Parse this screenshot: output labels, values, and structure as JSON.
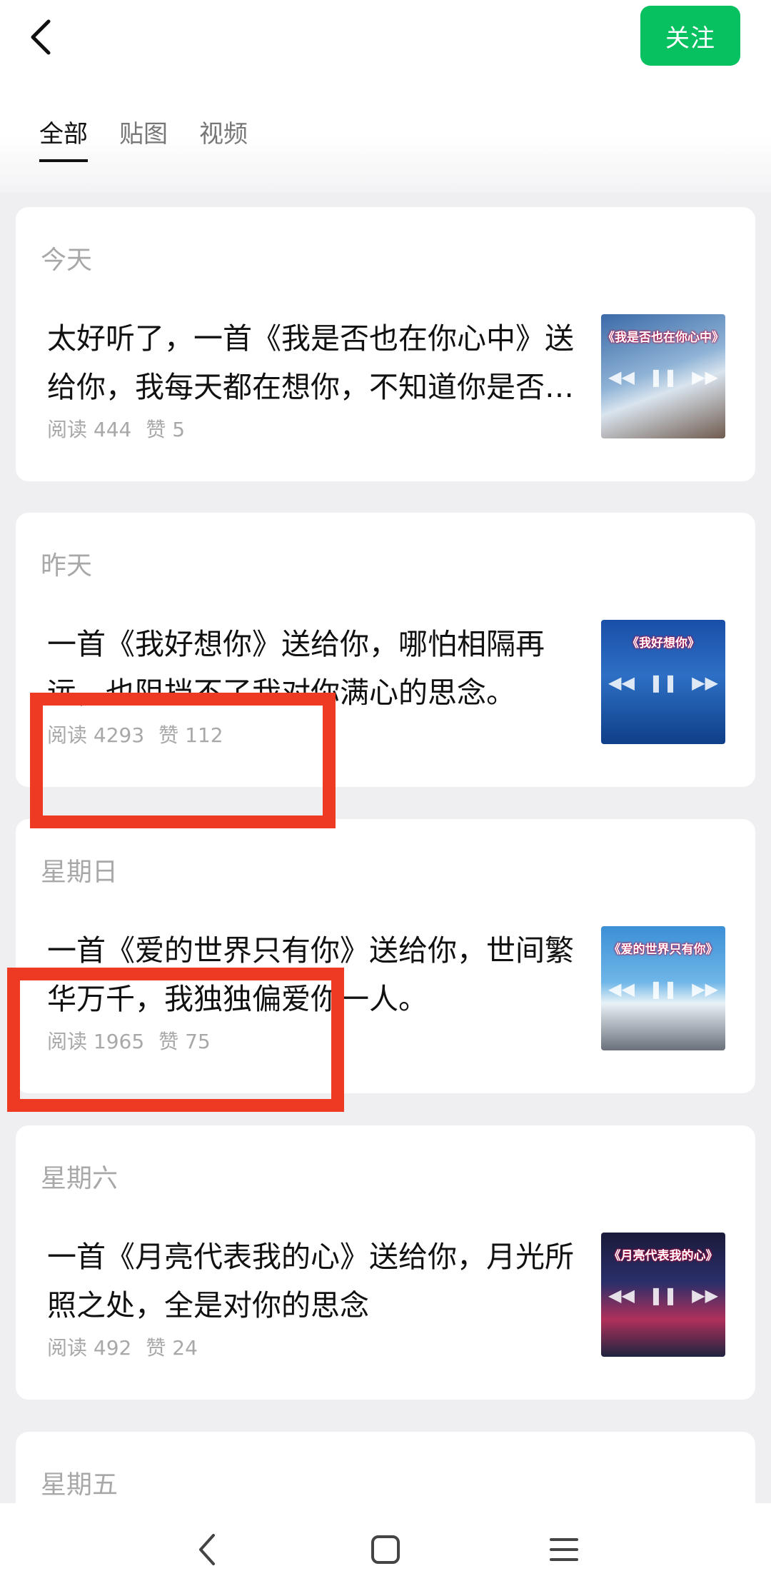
{
  "header": {
    "follow_label": "关注"
  },
  "tabs": [
    {
      "label": "全部",
      "active": true
    },
    {
      "label": "贴图",
      "active": false
    },
    {
      "label": "视频",
      "active": false
    }
  ],
  "posts": [
    {
      "date": "今天",
      "title": "太好听了，一首《我是否也在你心中》送给你，我每天都在想你，不知道你是否也在想我",
      "reads_label": "阅读 444",
      "likes_label": "赞 5",
      "thumb_caption": "《我是否也在你心中》"
    },
    {
      "date": "昨天",
      "title": "一首《我好想你》送给你，哪怕相隔再远，也阻挡不了我对你满心的思念。",
      "reads_label": "阅读 4293",
      "likes_label": "赞 112",
      "thumb_caption": "《我好想你》"
    },
    {
      "date": "星期日",
      "title": "一首《爱的世界只有你》送给你，世间繁华万千，我独独偏爱你一人。",
      "reads_label": "阅读 1965",
      "likes_label": "赞 75",
      "thumb_caption": "《爱的世界只有你》"
    },
    {
      "date": "星期六",
      "title": "一首《月亮代表我的心》送给你，月光所照之处，全是对你的思念",
      "reads_label": "阅读 492",
      "likes_label": "赞 24",
      "thumb_caption": "《月亮代表我的心》"
    },
    {
      "date": "星期五"
    }
  ],
  "colors": {
    "accent": "#07c160",
    "highlight_box": "#ef3a23",
    "page_bg": "#efeff1",
    "secondary_text": "#a8a8a8"
  },
  "icons": [
    "back-arrow-icon",
    "nav-back-icon",
    "nav-home-icon",
    "nav-menu-icon",
    "play-pause-icon"
  ]
}
